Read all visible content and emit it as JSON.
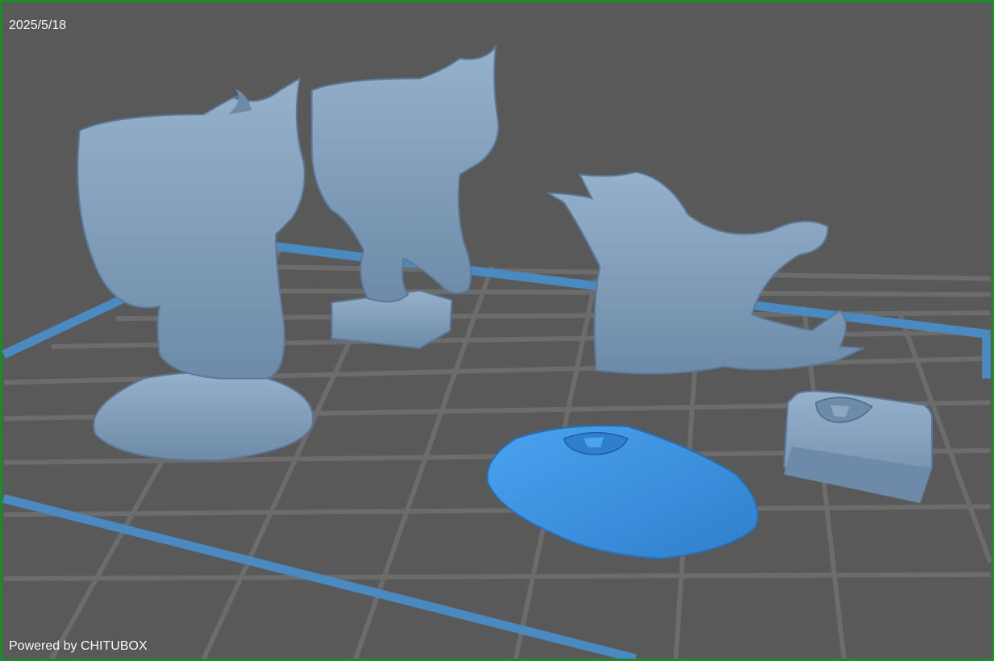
{
  "viewport": {
    "date_label": "2025/5/18",
    "watermark": "Powered by CHITUBOX"
  },
  "colors": {
    "background": "#595959",
    "frame_border": "#1f8a2a",
    "grid_line": "#6e6e6e",
    "platform_edge": "#4a8ac0",
    "model": "#7f9bb8",
    "model_shadow": "#5d7896",
    "selected_model": "#3a8fd8"
  },
  "models": [
    {
      "name": "lynx-on-rock-base",
      "selected": false
    },
    {
      "name": "lynx-on-square-base",
      "selected": false
    },
    {
      "name": "lynx-upper-body-part",
      "selected": false
    },
    {
      "name": "rock-base-part",
      "selected": true
    },
    {
      "name": "square-base-part",
      "selected": false
    }
  ]
}
